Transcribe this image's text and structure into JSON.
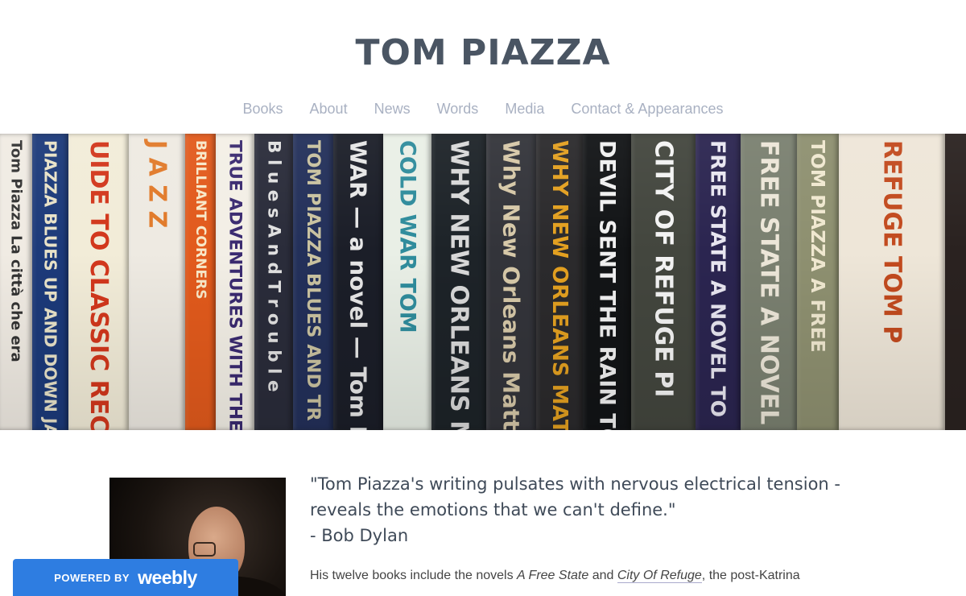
{
  "site": {
    "title": "TOM PIAZZA"
  },
  "nav": {
    "items": [
      "Books",
      "About",
      "News",
      "Words",
      "Media",
      "Contact & Appearances"
    ]
  },
  "banner": {
    "spines": [
      {
        "text": "Tom Piazza  La città che era",
        "bg": "#f0ebe3",
        "fg": "#333"
      },
      {
        "text": "PIAZZA  BLUES UP AND DOWN  JAZZ IN",
        "bg": "#1c3a7a",
        "fg": "#e8e2c8"
      },
      {
        "text": "UIDE TO CLASSIC RECOR",
        "bg": "#f2ecd8",
        "fg": "#d2371c"
      },
      {
        "text": "J A Z Z",
        "bg": "#eeeae2",
        "fg": "#e17a2a"
      },
      {
        "text": "BRILLIANT CORNERS",
        "bg": "#e25a1c",
        "fg": "#f8e8c8"
      },
      {
        "text": "TRUE ADVENTURES WITH THE KING OF BLUE",
        "bg": "#f3efe6",
        "fg": "#3a2a70"
      },
      {
        "text": "B l u e s  A n d  T r o u b l e",
        "bg": "#2a2c3a",
        "fg": "#e0e0e0"
      },
      {
        "text": "TOM PIAZZA  BLUES AND TR",
        "bg": "#23305a",
        "fg": "#c9c2a0"
      },
      {
        "text": "WAR — a novel — Tom F",
        "bg": "#1b1e28",
        "fg": "#e6e6e6"
      },
      {
        "text": "COLD WAR  TOM",
        "bg": "#e9efe6",
        "fg": "#2f8c9c"
      },
      {
        "text": "WHY NEW ORLEANS MATTERS",
        "bg": "#1d2328",
        "fg": "#d8d8d8"
      },
      {
        "text": "Why New Orleans Matters  TO",
        "bg": "#33343a",
        "fg": "#d6c8a8"
      },
      {
        "text": "WHY NEW ORLEANS MATTERS  TOM",
        "bg": "#2b2a2c",
        "fg": "#e3a020"
      },
      {
        "text": "DEVIL SENT THE RAIN  TOM",
        "bg": "#121416",
        "fg": "#f0f0f0"
      },
      {
        "text": "CITY OF REFUGE  PI",
        "bg": "#43463e",
        "fg": "#f3f3f3"
      },
      {
        "text": "FREE STATE  A NOVEL  TO",
        "bg": "#2b2550",
        "fg": "#e8e6f0"
      },
      {
        "text": "FREE STATE  A NOVEL  TOM",
        "bg": "#7a8070",
        "fg": "#ece6d8"
      },
      {
        "text": "TOM PIAZZA  A FREE",
        "bg": "#8e9070",
        "fg": "#f0e8d0"
      },
      {
        "text": "REFUGE  TOM P",
        "bg": "#eee6d8",
        "fg": "#c24a1e"
      }
    ]
  },
  "quote": {
    "line1": "\"Tom Piazza's writing pulsates with nervous electrical tension -",
    "line2": "reveals the emotions that we can't define.\"",
    "attribution": "- Bob Dylan"
  },
  "bio": {
    "prefix": "His twelve books include the novels ",
    "book1": "A Free State",
    "mid": " and ",
    "book2": "City Of Refuge",
    "suffix": ", the post-Katrina"
  },
  "badge": {
    "powered_by": "POWERED BY",
    "brand": "weebly"
  }
}
